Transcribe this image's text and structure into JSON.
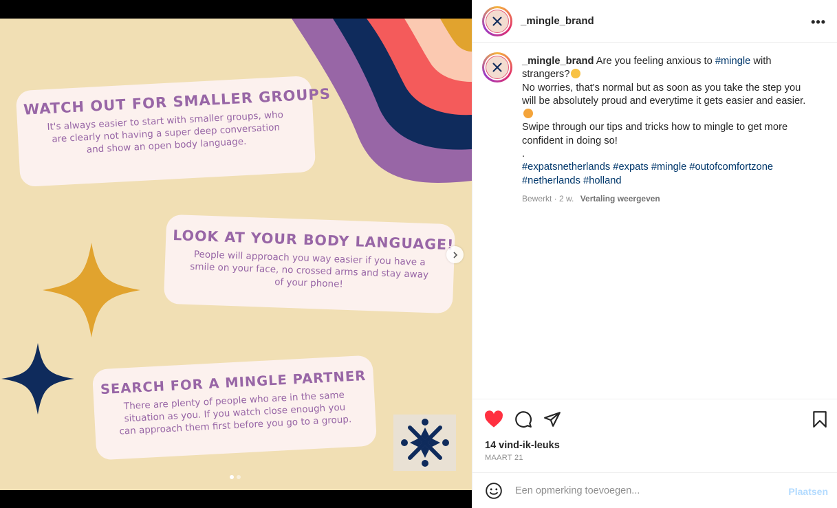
{
  "post": {
    "username": "_mingle_brand",
    "more_icon": "ellipsis-icon",
    "caption_parts": {
      "line1": "Are you feeling anxious to",
      "tag_mingle": "#mingle",
      "line1b": "with strangers?",
      "line2": "No worries, that's normal but as soon as you take the step you will be absolutely proud and everytime it gets easier and easier.",
      "line3": "Swipe through our tips and tricks how to mingle to get more confident in doing so!",
      "dot": ".",
      "tags": [
        "#expatsnetherlands",
        "#expats",
        "#mingle",
        "#outofcomfortzone",
        "#netherlands",
        "#holland"
      ]
    },
    "edited": "Bewerkt · 2 w.",
    "translate": "Vertaling weergeven",
    "likes": "14 vind-ik-leuks",
    "date": "MAART 21",
    "comment_placeholder": "Een opmerking toevoegen...",
    "post_button": "Plaatsen"
  },
  "slide": {
    "tips": [
      {
        "title": "Watch out for smaller groups",
        "body": "It's always easier to start with smaller groups, who are clearly not having a super deep conversation and show an open body language."
      },
      {
        "title": "Look at your body language!",
        "body": "People will approach you way easier if you have a smile on your face, no crossed arms and stay away of your phone!"
      },
      {
        "title": "Search for a mingle partner",
        "body": "There are plenty of people who are in the same situation as you. If you watch close enough you can approach them first before you go to a group."
      }
    ],
    "dots_total": 2,
    "dots_active": 1,
    "colors": {
      "background": "#f1dfb4",
      "card": "#fcf1ee",
      "text": "#9866a6",
      "purple": "#9866a6",
      "navy": "#0f2b5c",
      "coral": "#f45b5b",
      "peach": "#fbc9b1",
      "gold": "#e1a32e"
    }
  },
  "icons": [
    "heart-filled-icon",
    "comment-icon",
    "share-icon",
    "bookmark-icon",
    "smiley-icon",
    "chevron-right-icon"
  ],
  "colors": {
    "like": "#ff3040",
    "link": "#00376b",
    "muted": "#8e8e8e",
    "post_disabled": "#b3dbff"
  }
}
